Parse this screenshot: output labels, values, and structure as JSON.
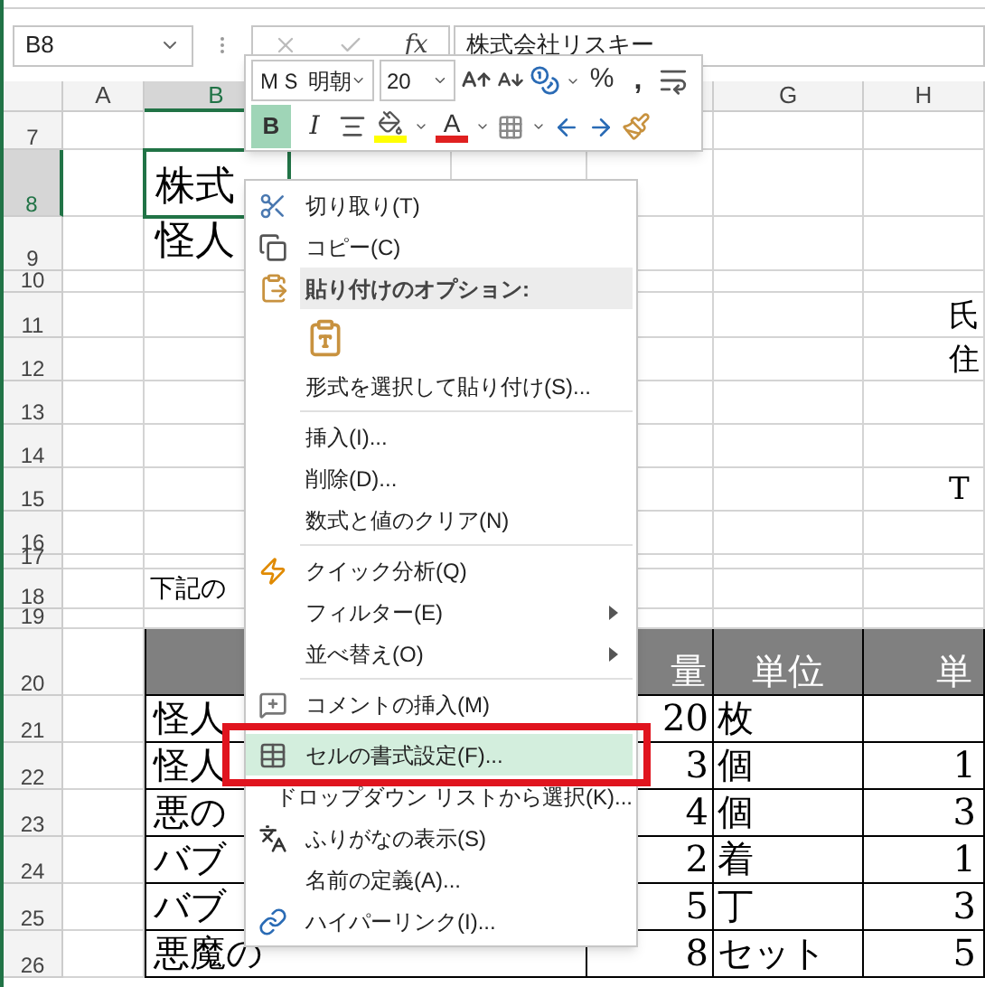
{
  "formula_bar": {
    "name_box": "B8",
    "fx_label": "fx",
    "content": "株式会社リスキー"
  },
  "columns": [
    {
      "label": "A",
      "selected": false
    },
    {
      "label": "B",
      "selected": true
    },
    {
      "label": "G",
      "selected": false
    },
    {
      "label": "H",
      "selected": false
    }
  ],
  "rows": [
    {
      "number": "7",
      "selected": false,
      "kind": "plain",
      "cells": {}
    },
    {
      "number": "8",
      "selected": true,
      "kind": "title",
      "cells": {
        "B": "株式"
      }
    },
    {
      "number": "9",
      "selected": false,
      "kind": "title",
      "cells": {
        "B": "怪人"
      }
    },
    {
      "number": "10",
      "selected": false,
      "kind": "plain",
      "cells": {}
    },
    {
      "number": "11",
      "selected": false,
      "kind": "plain",
      "cells": {
        "H": "氏"
      }
    },
    {
      "number": "12",
      "selected": false,
      "kind": "plain",
      "cells": {
        "H": "住"
      }
    },
    {
      "number": "13",
      "selected": false,
      "kind": "plain",
      "cells": {}
    },
    {
      "number": "14",
      "selected": false,
      "kind": "plain",
      "cells": {}
    },
    {
      "number": "15",
      "selected": false,
      "kind": "plain",
      "cells": {
        "H": "T"
      }
    },
    {
      "number": "16",
      "selected": false,
      "kind": "plain",
      "cells": {}
    },
    {
      "number": "17",
      "selected": false,
      "kind": "plain",
      "cells": {}
    },
    {
      "number": "18",
      "selected": false,
      "kind": "plain",
      "cells": {
        "B": "下記の"
      }
    },
    {
      "number": "19",
      "selected": false,
      "kind": "plain",
      "cells": {}
    },
    {
      "number": "20",
      "selected": false,
      "kind": "table_header",
      "cells": {
        "quantity": "量",
        "unit": "単位",
        "price": "単"
      }
    },
    {
      "number": "21",
      "selected": false,
      "kind": "table_row",
      "cells": {
        "name": "怪人",
        "quantity": "20",
        "unit": "枚"
      }
    },
    {
      "number": "22",
      "selected": false,
      "kind": "table_row",
      "cells": {
        "name": "怪人",
        "quantity": "3",
        "unit": "個",
        "price": "1"
      }
    },
    {
      "number": "23",
      "selected": false,
      "kind": "table_row",
      "cells": {
        "name": "悪の",
        "quantity": "4",
        "unit": "個",
        "price": "3"
      }
    },
    {
      "number": "24",
      "selected": false,
      "kind": "table_row",
      "cells": {
        "name": "バブ",
        "quantity": "2",
        "unit": "着",
        "price": "1"
      }
    },
    {
      "number": "25",
      "selected": false,
      "kind": "table_row",
      "cells": {
        "name": "バブ",
        "quantity": "5",
        "unit": "丁",
        "price": "3"
      }
    },
    {
      "number": "26",
      "selected": false,
      "kind": "table_row",
      "cells": {
        "name": "悪魔の",
        "quantity": "8",
        "unit": "セット",
        "price": "5"
      }
    }
  ],
  "mini_toolbar": {
    "font_name": "ＭＳ 明朝",
    "font_size": "20",
    "percent": "%",
    "comma": ",",
    "bold": {
      "label": "B",
      "selected": true
    },
    "italic": {
      "label": "I",
      "selected": false
    },
    "font_color_label": "A"
  },
  "context_menu": [
    {
      "kind": "item",
      "label": "切り取り(T)",
      "selected": false
    },
    {
      "kind": "item",
      "label": "コピー(C)",
      "selected": false
    },
    {
      "kind": "header",
      "label": "貼り付けのオプション:"
    },
    {
      "kind": "paste_options"
    },
    {
      "kind": "item",
      "label": "形式を選択して貼り付け(S)...",
      "selected": false
    },
    {
      "kind": "separator"
    },
    {
      "kind": "item",
      "label": "挿入(I)...",
      "selected": false
    },
    {
      "kind": "item",
      "label": "削除(D)...",
      "selected": false
    },
    {
      "kind": "item",
      "label": "数式と値のクリア(N)",
      "selected": false
    },
    {
      "kind": "separator"
    },
    {
      "kind": "item",
      "label": "クイック分析(Q)",
      "selected": false
    },
    {
      "kind": "item",
      "label": "フィルター(E)",
      "selected": false,
      "submenu": true
    },
    {
      "kind": "item",
      "label": "並べ替え(O)",
      "selected": false,
      "submenu": true
    },
    {
      "kind": "separator"
    },
    {
      "kind": "item",
      "label": "コメントの挿入(M)",
      "selected": false
    },
    {
      "kind": "separator"
    },
    {
      "kind": "item",
      "label": "セルの書式設定(F)...",
      "selected": true,
      "framed": true
    },
    {
      "kind": "item",
      "label": "ドロップダウン リストから選択(K)...",
      "selected": false
    },
    {
      "kind": "item",
      "label": "ふりがなの表示(S)",
      "selected": false
    },
    {
      "kind": "item",
      "label": "名前の定義(A)...",
      "selected": false
    },
    {
      "kind": "item",
      "label": "ハイパーリンク(I)...",
      "selected": false
    }
  ]
}
